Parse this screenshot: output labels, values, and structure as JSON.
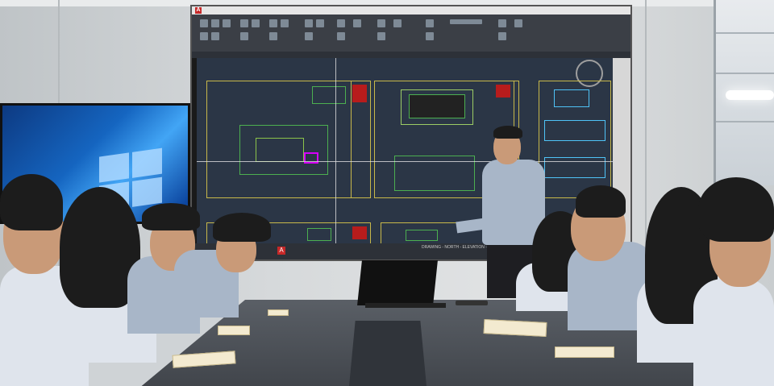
{
  "scene": {
    "kind": "meeting-room-photo",
    "accent_colors": {
      "wall": "#d6d9db",
      "cad_background": "#2b3646",
      "cad_linework_green": "#4caf50",
      "cad_linework_yellow": "#c8b84a",
      "tv_blue": "#1565c0",
      "table": "#4a4f55"
    }
  },
  "projection": {
    "software_icon": "autocad-icon",
    "window_title_letter": "A",
    "status_line": "DRAWING - NORTH - ELEVATION - STYLE",
    "taskbar_app_letter": "A"
  },
  "tv": {
    "screen": "windows-desktop"
  }
}
